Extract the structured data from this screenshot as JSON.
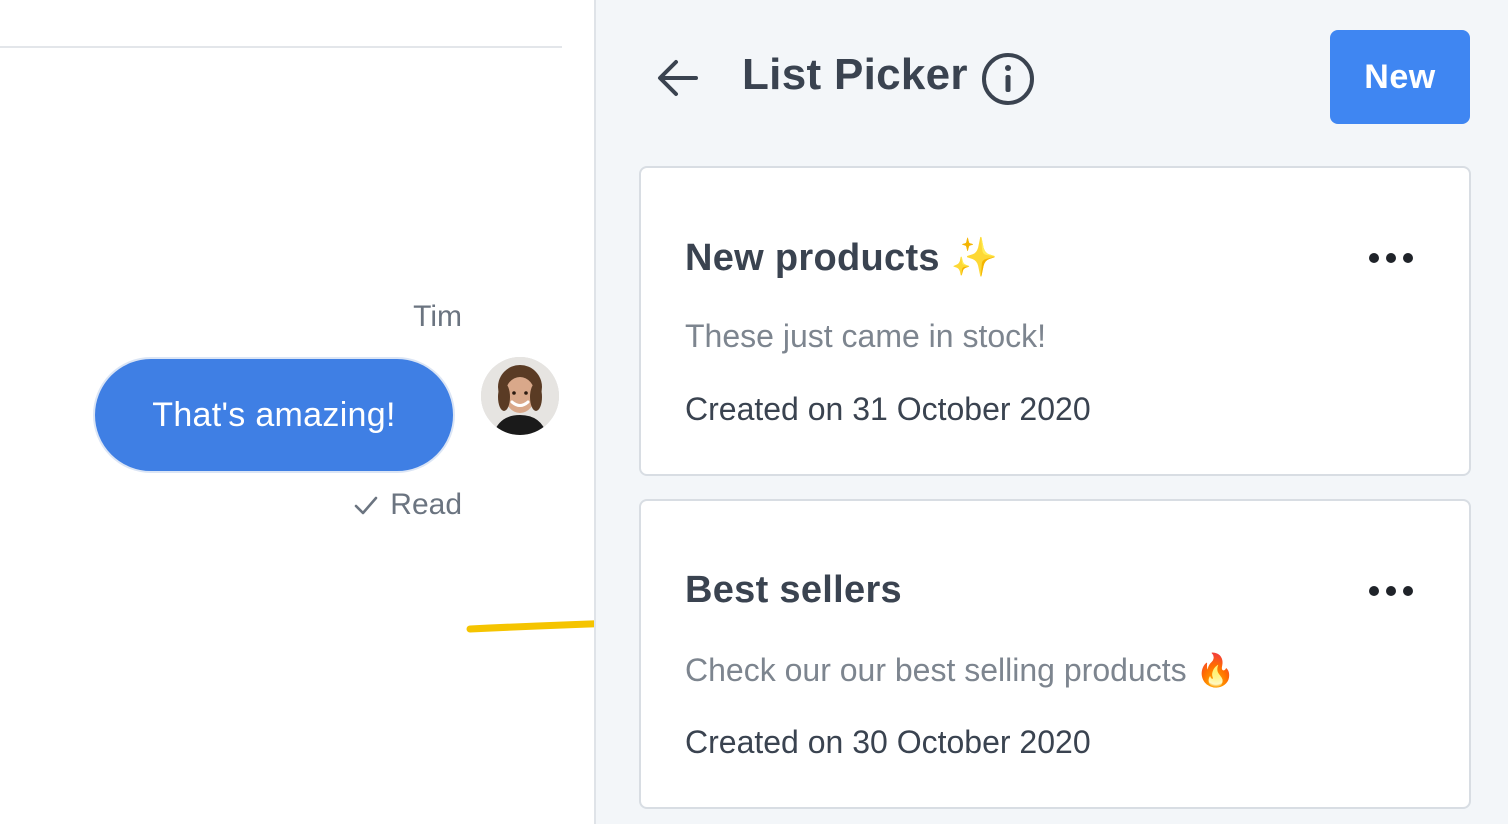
{
  "chat": {
    "sender_name": "Tim",
    "message": "That's amazing!",
    "read_status": "Read"
  },
  "panel": {
    "title": "List Picker",
    "new_button_label": "New",
    "back_icon": "arrow-left-icon",
    "info_icon": "info-circle-icon"
  },
  "lists": [
    {
      "title": "New products ✨",
      "description": "These just came in stock!",
      "created": "Created on 31 October 2020"
    },
    {
      "title": "Best sellers",
      "description": "Check our our best selling products 🔥",
      "created": "Created on 30 October 2020"
    }
  ],
  "colors": {
    "accent": "#3f86f2",
    "bubble": "#3f7fe4",
    "panel_bg": "#f3f6f9",
    "annotation": "#f5c400"
  }
}
